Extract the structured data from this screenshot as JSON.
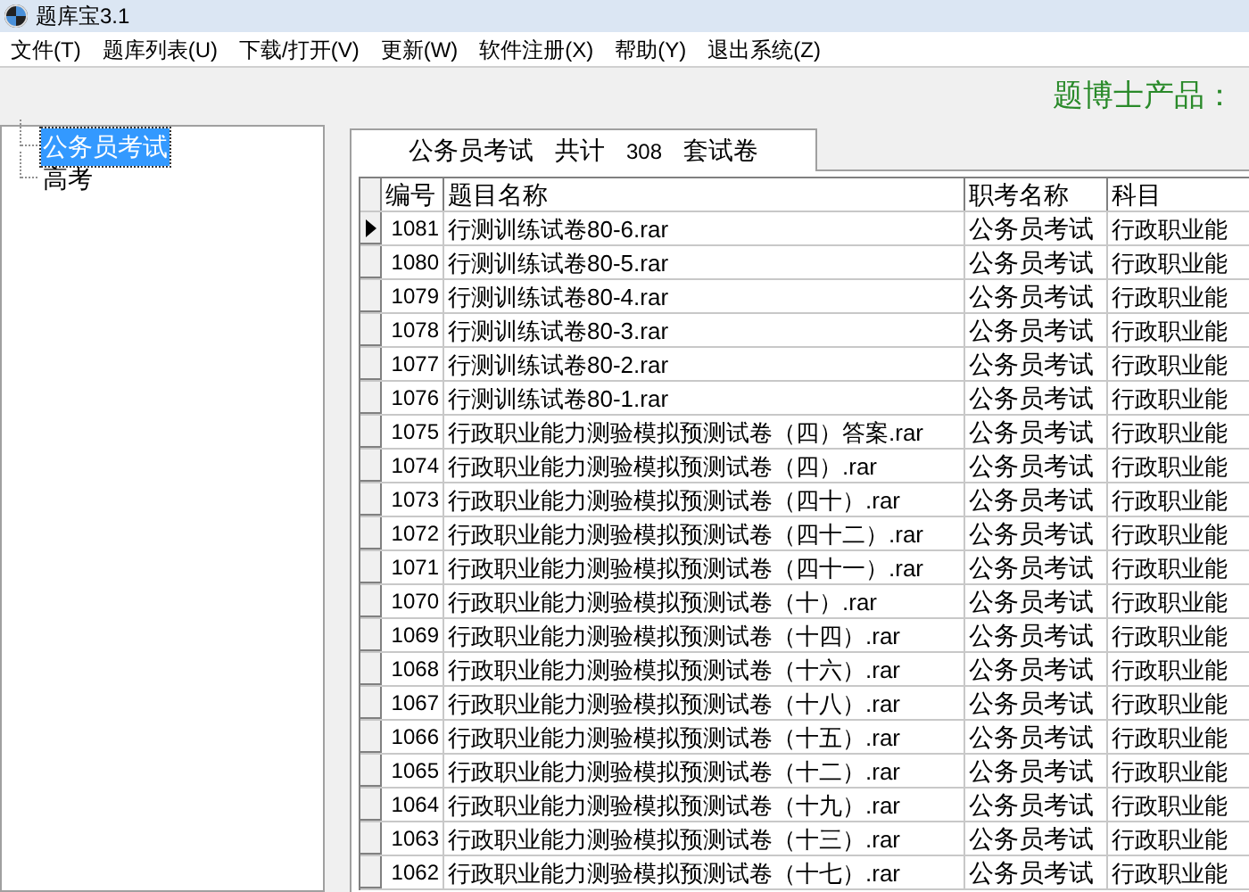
{
  "window": {
    "title": "题库宝3.1"
  },
  "menu": [
    "文件(T)",
    "题库列表(U)",
    "下载/打开(V)",
    "更新(W)",
    "软件注册(X)",
    "帮助(Y)",
    "退出系统(Z)"
  ],
  "brand": "题博士产品：",
  "tree": [
    {
      "label": "公务员考试",
      "selected": true
    },
    {
      "label": "高考",
      "selected": false
    }
  ],
  "tab": {
    "category": "公务员考试",
    "total_label": "共计",
    "count": "308",
    "unit": "套试卷"
  },
  "table": {
    "columns": [
      "编号",
      "题目名称",
      "职考名称",
      "科目"
    ],
    "rows": [
      {
        "id": "1081",
        "name": "行测训练试卷80-6.rar",
        "category": "公务员考试",
        "subject": "行政职业能",
        "selected": true
      },
      {
        "id": "1080",
        "name": "行测训练试卷80-5.rar",
        "category": "公务员考试",
        "subject": "行政职业能",
        "selected": false
      },
      {
        "id": "1079",
        "name": "行测训练试卷80-4.rar",
        "category": "公务员考试",
        "subject": "行政职业能",
        "selected": false
      },
      {
        "id": "1078",
        "name": "行测训练试卷80-3.rar",
        "category": "公务员考试",
        "subject": "行政职业能",
        "selected": false
      },
      {
        "id": "1077",
        "name": "行测训练试卷80-2.rar",
        "category": "公务员考试",
        "subject": "行政职业能",
        "selected": false
      },
      {
        "id": "1076",
        "name": "行测训练试卷80-1.rar",
        "category": "公务员考试",
        "subject": "行政职业能",
        "selected": false
      },
      {
        "id": "1075",
        "name": "行政职业能力测验模拟预测试卷（四）答案.rar",
        "category": "公务员考试",
        "subject": "行政职业能",
        "selected": false
      },
      {
        "id": "1074",
        "name": "行政职业能力测验模拟预测试卷（四）.rar",
        "category": "公务员考试",
        "subject": "行政职业能",
        "selected": false
      },
      {
        "id": "1073",
        "name": "行政职业能力测验模拟预测试卷（四十）.rar",
        "category": "公务员考试",
        "subject": "行政职业能",
        "selected": false
      },
      {
        "id": "1072",
        "name": "行政职业能力测验模拟预测试卷（四十二）.rar",
        "category": "公务员考试",
        "subject": "行政职业能",
        "selected": false
      },
      {
        "id": "1071",
        "name": "行政职业能力测验模拟预测试卷（四十一）.rar",
        "category": "公务员考试",
        "subject": "行政职业能",
        "selected": false
      },
      {
        "id": "1070",
        "name": "行政职业能力测验模拟预测试卷（十）.rar",
        "category": "公务员考试",
        "subject": "行政职业能",
        "selected": false
      },
      {
        "id": "1069",
        "name": "行政职业能力测验模拟预测试卷（十四）.rar",
        "category": "公务员考试",
        "subject": "行政职业能",
        "selected": false
      },
      {
        "id": "1068",
        "name": "行政职业能力测验模拟预测试卷（十六）.rar",
        "category": "公务员考试",
        "subject": "行政职业能",
        "selected": false
      },
      {
        "id": "1067",
        "name": "行政职业能力测验模拟预测试卷（十八）.rar",
        "category": "公务员考试",
        "subject": "行政职业能",
        "selected": false
      },
      {
        "id": "1066",
        "name": "行政职业能力测验模拟预测试卷（十五）.rar",
        "category": "公务员考试",
        "subject": "行政职业能",
        "selected": false
      },
      {
        "id": "1065",
        "name": "行政职业能力测验模拟预测试卷（十二）.rar",
        "category": "公务员考试",
        "subject": "行政职业能",
        "selected": false
      },
      {
        "id": "1064",
        "name": "行政职业能力测验模拟预测试卷（十九）.rar",
        "category": "公务员考试",
        "subject": "行政职业能",
        "selected": false
      },
      {
        "id": "1063",
        "name": "行政职业能力测验模拟预测试卷（十三）.rar",
        "category": "公务员考试",
        "subject": "行政职业能",
        "selected": false
      },
      {
        "id": "1062",
        "name": "行政职业能力测验模拟预测试卷（十七）.rar",
        "category": "公务员考试",
        "subject": "行政职业能",
        "selected": false
      }
    ]
  }
}
